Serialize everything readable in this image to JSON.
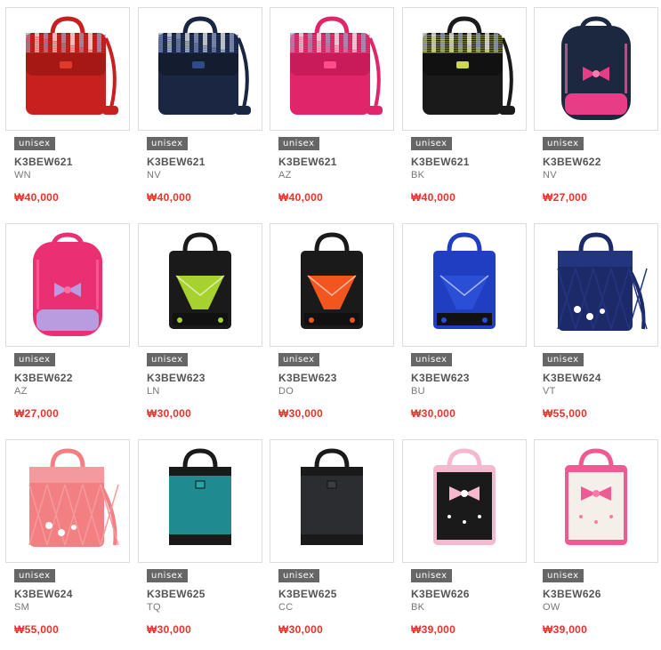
{
  "products": [
    {
      "badge": "unisex",
      "code": "K3BEW621",
      "color": "WN",
      "price": "₩40,000",
      "style": "messenger",
      "body": "#c8201e",
      "flap": "#a51814",
      "accent": "#e03a2c",
      "plaid": true
    },
    {
      "badge": "unisex",
      "code": "K3BEW621",
      "color": "NV",
      "price": "₩40,000",
      "style": "messenger",
      "body": "#1b2742",
      "flap": "#141c30",
      "accent": "#2f4a8a",
      "plaid": true
    },
    {
      "badge": "unisex",
      "code": "K3BEW621",
      "color": "AZ",
      "price": "₩40,000",
      "style": "messenger",
      "body": "#e0256a",
      "flap": "#c91a5a",
      "accent": "#ff4d8b",
      "plaid": true
    },
    {
      "badge": "unisex",
      "code": "K3BEW621",
      "color": "BK",
      "price": "₩40,000",
      "style": "messenger",
      "body": "#1a1a1a",
      "flap": "#111111",
      "accent": "#cfd84a",
      "plaid": true
    },
    {
      "badge": "unisex",
      "code": "K3BEW622",
      "color": "NV",
      "price": "₩27,000",
      "style": "backpack",
      "body": "#1c2740",
      "flap": "#e63d86",
      "accent": "#ff7ab2",
      "plaid": false
    },
    {
      "badge": "unisex",
      "code": "K3BEW622",
      "color": "AZ",
      "price": "₩27,000",
      "style": "backpack",
      "body": "#ea2f72",
      "flap": "#b99be0",
      "accent": "#ff6fa3",
      "plaid": false
    },
    {
      "badge": "unisex",
      "code": "K3BEW623",
      "color": "LN",
      "price": "₩30,000",
      "style": "tote",
      "body": "#1a1a1a",
      "flap": "#a7d12e",
      "accent": "#f2f2f2",
      "plaid": false
    },
    {
      "badge": "unisex",
      "code": "K3BEW623",
      "color": "DO",
      "price": "₩30,000",
      "style": "tote",
      "body": "#1a1a1a",
      "flap": "#f2561e",
      "accent": "#f2f2f2",
      "plaid": false
    },
    {
      "badge": "unisex",
      "code": "K3BEW623",
      "color": "BU",
      "price": "₩30,000",
      "style": "tote",
      "body": "#1f3ec2",
      "flap": "#2a4fd6",
      "accent": "#f2f2f2",
      "plaid": false
    },
    {
      "badge": "unisex",
      "code": "K3BEW624",
      "color": "VT",
      "price": "₩55,000",
      "style": "quilted",
      "body": "#1c2a6a",
      "flap": "#243580",
      "accent": "#ffffff",
      "plaid": false
    },
    {
      "badge": "unisex",
      "code": "K3BEW624",
      "color": "SM",
      "price": "₩55,000",
      "style": "quilted",
      "body": "#f27f82",
      "flap": "#f59a9c",
      "accent": "#ffffff",
      "plaid": false
    },
    {
      "badge": "unisex",
      "code": "K3BEW625",
      "color": "TQ",
      "price": "₩30,000",
      "style": "simple",
      "body": "#1f8a90",
      "flap": "#1a1a1a",
      "accent": "#2aa3aa",
      "plaid": false
    },
    {
      "badge": "unisex",
      "code": "K3BEW625",
      "color": "CC",
      "price": "₩30,000",
      "style": "simple",
      "body": "#2b2d31",
      "flap": "#1a1a1a",
      "accent": "#3a3d42",
      "plaid": false
    },
    {
      "badge": "unisex",
      "code": "K3BEW626",
      "color": "BK",
      "price": "₩39,000",
      "style": "bowtote",
      "body": "#1a1a1a",
      "flap": "#f4b8cf",
      "accent": "#ffffff",
      "plaid": false
    },
    {
      "badge": "unisex",
      "code": "K3BEW626",
      "color": "OW",
      "price": "₩39,000",
      "style": "bowtote",
      "body": "#f4efe8",
      "flap": "#f05a93",
      "accent": "#ff7aa8",
      "plaid": false
    }
  ]
}
